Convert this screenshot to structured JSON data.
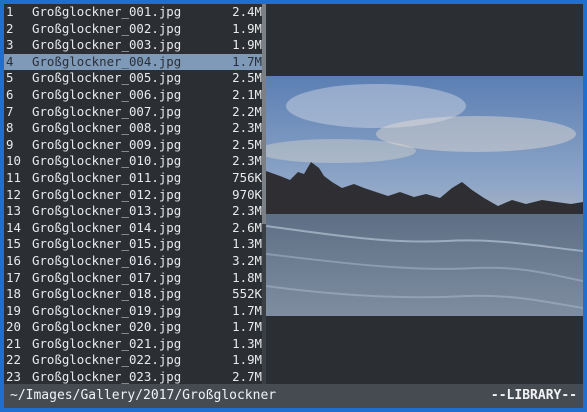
{
  "files": [
    {
      "index": "1",
      "name": "Großglockner_001.jpg",
      "size": "2.4M"
    },
    {
      "index": "2",
      "name": "Großglockner_002.jpg",
      "size": "1.9M"
    },
    {
      "index": "3",
      "name": "Großglockner_003.jpg",
      "size": "1.9M"
    },
    {
      "index": "4",
      "name": "Großglockner_004.jpg",
      "size": "1.7M"
    },
    {
      "index": "5",
      "name": "Großglockner_005.jpg",
      "size": "2.5M"
    },
    {
      "index": "6",
      "name": "Großglockner_006.jpg",
      "size": "2.1M"
    },
    {
      "index": "7",
      "name": "Großglockner_007.jpg",
      "size": "2.2M"
    },
    {
      "index": "8",
      "name": "Großglockner_008.jpg",
      "size": "2.3M"
    },
    {
      "index": "9",
      "name": "Großglockner_009.jpg",
      "size": "2.5M"
    },
    {
      "index": "10",
      "name": "Großglockner_010.jpg",
      "size": "2.3M"
    },
    {
      "index": "11",
      "name": "Großglockner_011.jpg",
      "size": "756K"
    },
    {
      "index": "12",
      "name": "Großglockner_012.jpg",
      "size": "970K"
    },
    {
      "index": "13",
      "name": "Großglockner_013.jpg",
      "size": "2.3M"
    },
    {
      "index": "14",
      "name": "Großglockner_014.jpg",
      "size": "2.6M"
    },
    {
      "index": "15",
      "name": "Großglockner_015.jpg",
      "size": "1.3M"
    },
    {
      "index": "16",
      "name": "Großglockner_016.jpg",
      "size": "3.2M"
    },
    {
      "index": "17",
      "name": "Großglockner_017.jpg",
      "size": "1.8M"
    },
    {
      "index": "18",
      "name": "Großglockner_018.jpg",
      "size": "552K"
    },
    {
      "index": "19",
      "name": "Großglockner_019.jpg",
      "size": "1.7M"
    },
    {
      "index": "20",
      "name": "Großglockner_020.jpg",
      "size": "1.7M"
    },
    {
      "index": "21",
      "name": "Großglockner_021.jpg",
      "size": "1.3M"
    },
    {
      "index": "22",
      "name": "Großglockner_022.jpg",
      "size": "1.9M"
    },
    {
      "index": "23",
      "name": "Großglockner_023.jpg",
      "size": "2.7M"
    }
  ],
  "selected_index": 3,
  "status": {
    "path": "~/Images/Gallery/2017/Großglockner",
    "mode": "--LIBRARY--"
  },
  "colors": {
    "window_border": "#1e6fd0",
    "background": "#2b2f33",
    "selection": "#7f9ab8",
    "statusbar": "#464b52"
  }
}
